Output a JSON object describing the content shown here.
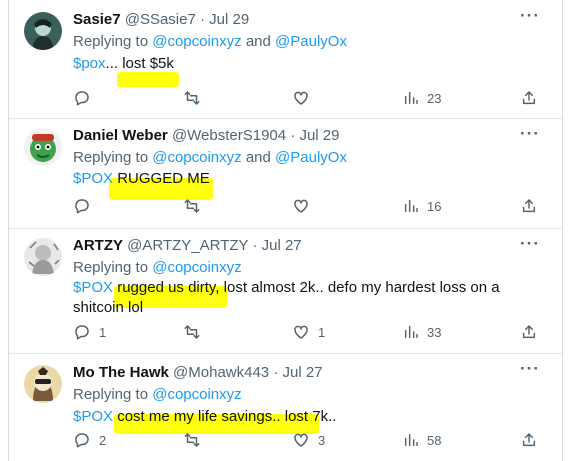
{
  "tweets": [
    {
      "name": "Sasie7",
      "handle": "@SSasie7",
      "dot": "·",
      "date": "Jul 29",
      "replying_prefix": "Replying to",
      "mention1": "@copcoinxyz",
      "and_word": "and",
      "mention2": "@PaulyOx",
      "cashtag": "$pox",
      "text": "... lost $5k",
      "reply_count": "",
      "retweet_count": "",
      "like_count": "",
      "views": "23"
    },
    {
      "name": "Daniel Weber",
      "handle": "@WebsterS1904",
      "dot": "·",
      "date": "Jul 29",
      "replying_prefix": "Replying to",
      "mention1": "@copcoinxyz",
      "and_word": "and",
      "mention2": "@PaulyOx",
      "cashtag": "$POX",
      "text": " RUGGED ME",
      "reply_count": "",
      "retweet_count": "",
      "like_count": "",
      "views": "16"
    },
    {
      "name": "ARTZY",
      "handle": "@ARTZY_ARTZY",
      "dot": "·",
      "date": "Jul 27",
      "replying_prefix": "Replying to",
      "mention1": "@copcoinxyz",
      "cashtag": "$POX",
      "text": " rugged us dirty, lost almost 2k.. defo my hardest loss on a shitcoin lol",
      "reply_count": "1",
      "retweet_count": "",
      "like_count": "1",
      "views": "33"
    },
    {
      "name": "Mo The Hawk",
      "handle": "@Mohawk443",
      "dot": "·",
      "date": "Jul 27",
      "replying_prefix": "Replying to",
      "mention1": "@copcoinxyz",
      "cashtag": "$POX",
      "text": " cost me my life savings.. lost 7k..",
      "reply_count": "2",
      "retweet_count": "",
      "like_count": "3",
      "views": "58"
    }
  ],
  "more_glyph": "···",
  "colors": {
    "text": "#0f1419",
    "secondary": "#536471",
    "link": "#1d9bf0",
    "highlight": "#ffff00",
    "divider": "#e7e9ea"
  },
  "icons": [
    "more-icon",
    "reply-icon",
    "retweet-icon",
    "like-icon",
    "views-icon",
    "share-icon"
  ]
}
